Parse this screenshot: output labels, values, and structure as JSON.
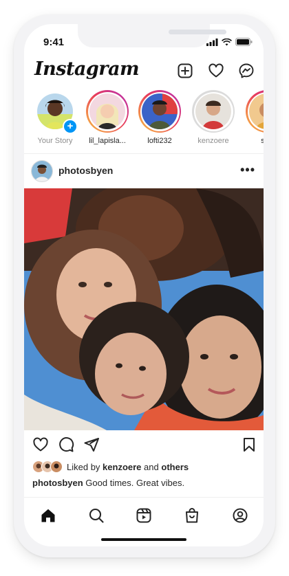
{
  "status": {
    "time": "9:41"
  },
  "header": {
    "logo": "Instagram"
  },
  "stories": [
    {
      "label": "Your Story",
      "own": true
    },
    {
      "label": "lil_lapisla...",
      "own": false
    },
    {
      "label": "lofti232",
      "own": false
    },
    {
      "label": "kenzoere",
      "own": false,
      "seen": true
    },
    {
      "label": "sap",
      "own": false
    }
  ],
  "post": {
    "username": "photosbyen",
    "more": "•••",
    "liked_prefix": "Liked by",
    "liked_user": "kenzoere",
    "liked_and": "and",
    "liked_others": "others",
    "caption_user": "photosbyen",
    "caption_text": "Good times. Great vibes."
  },
  "colors": {
    "accent": "#0095f6",
    "ring_start": "#f9c440",
    "ring_mid": "#e83c5b",
    "ring_end": "#b52fb8"
  },
  "icons": [
    "new-post-icon",
    "heart-icon",
    "messenger-icon",
    "like-icon",
    "comment-icon",
    "share-icon",
    "save-icon",
    "home-icon",
    "search-icon",
    "reels-icon",
    "shop-icon",
    "profile-icon"
  ]
}
